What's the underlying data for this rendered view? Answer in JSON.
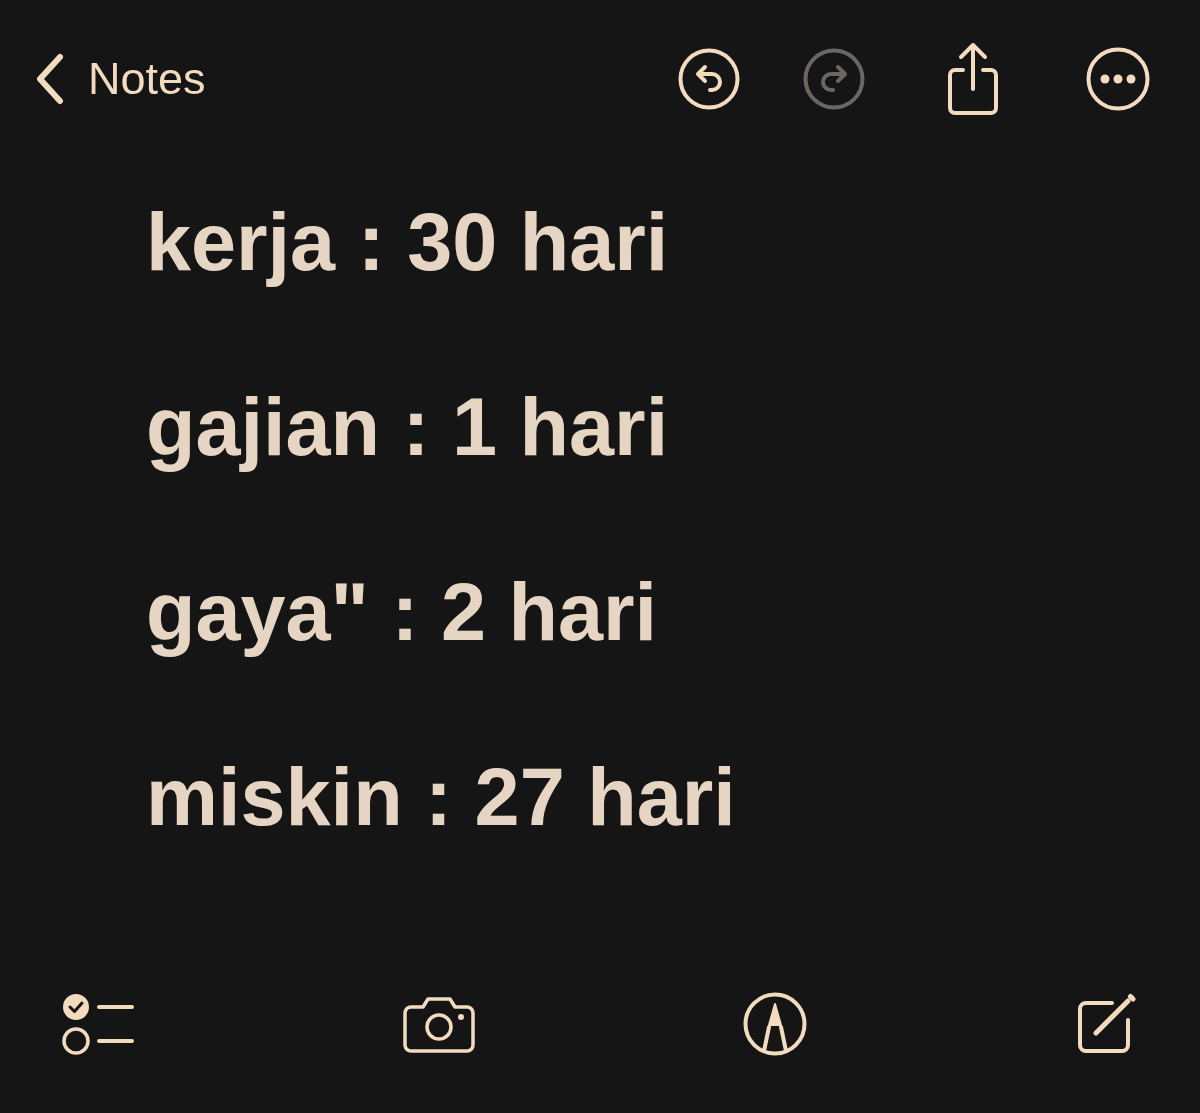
{
  "top_bar": {
    "back_label": "Notes",
    "actions": [
      {
        "disabled": false
      },
      {
        "disabled": true
      },
      {
        "disabled": false
      },
      {
        "disabled": false
      }
    ]
  },
  "note": {
    "lines": [
      "kerja : 30 hari",
      "gajian : 1 hari",
      "gaya\" : 2 hari",
      "miskin : 27 hari"
    ]
  }
}
